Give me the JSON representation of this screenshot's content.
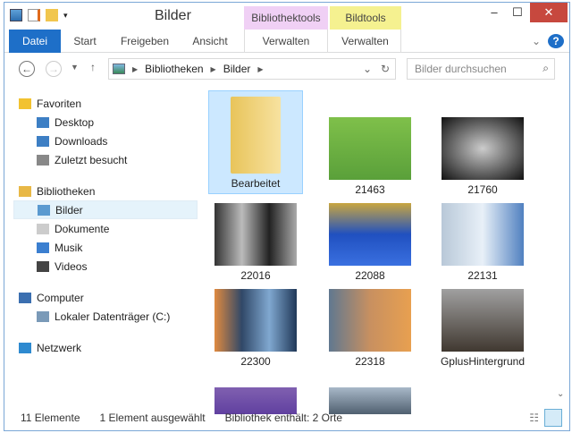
{
  "window": {
    "title": "Bilder",
    "context_tabs": [
      {
        "label": "Bibliothektools",
        "color": "#f0d0f5"
      },
      {
        "label": "Bildtools",
        "color": "#f5f190"
      }
    ]
  },
  "ribbon": {
    "tabs": [
      "Datei",
      "Start",
      "Freigeben",
      "Ansicht",
      "Verwalten",
      "Verwalten"
    ],
    "accent": "#1e6fc8"
  },
  "address": {
    "crumbs": [
      "Bibliotheken",
      "Bilder"
    ],
    "search_placeholder": "Bilder durchsuchen"
  },
  "nav": {
    "items": [
      {
        "label": "Favoriten",
        "icon": "star-icon",
        "level": 0
      },
      {
        "label": "Desktop",
        "icon": "desktop-icon",
        "level": 1
      },
      {
        "label": "Downloads",
        "icon": "downloads-icon",
        "level": 1
      },
      {
        "label": "Zuletzt besucht",
        "icon": "recent-icon",
        "level": 1
      },
      {
        "label": "Bibliotheken",
        "icon": "libraries-icon",
        "level": 0
      },
      {
        "label": "Bilder",
        "icon": "pictures-icon",
        "level": 1,
        "selected": true
      },
      {
        "label": "Dokumente",
        "icon": "documents-icon",
        "level": 1
      },
      {
        "label": "Musik",
        "icon": "music-icon",
        "level": 1
      },
      {
        "label": "Videos",
        "icon": "videos-icon",
        "level": 1
      },
      {
        "label": "Computer",
        "icon": "computer-icon",
        "level": 0
      },
      {
        "label": "Lokaler Datenträger (C:)",
        "icon": "drive-icon",
        "level": 1
      },
      {
        "label": "Netzwerk",
        "icon": "network-icon",
        "level": 0
      }
    ]
  },
  "files": [
    {
      "name": "Bearbeitet",
      "type": "folder",
      "selected": true
    },
    {
      "name": "21463"
    },
    {
      "name": "21760"
    },
    {
      "name": "22016"
    },
    {
      "name": "22088"
    },
    {
      "name": "22131"
    },
    {
      "name": "22300"
    },
    {
      "name": "22318"
    },
    {
      "name": "GplusHintergrund"
    },
    {
      "name": ""
    },
    {
      "name": ""
    }
  ],
  "status": {
    "count": "11 Elemente",
    "selected": "1 Element ausgewählt",
    "library": "Bibliothek enthält: 2 Orte"
  }
}
